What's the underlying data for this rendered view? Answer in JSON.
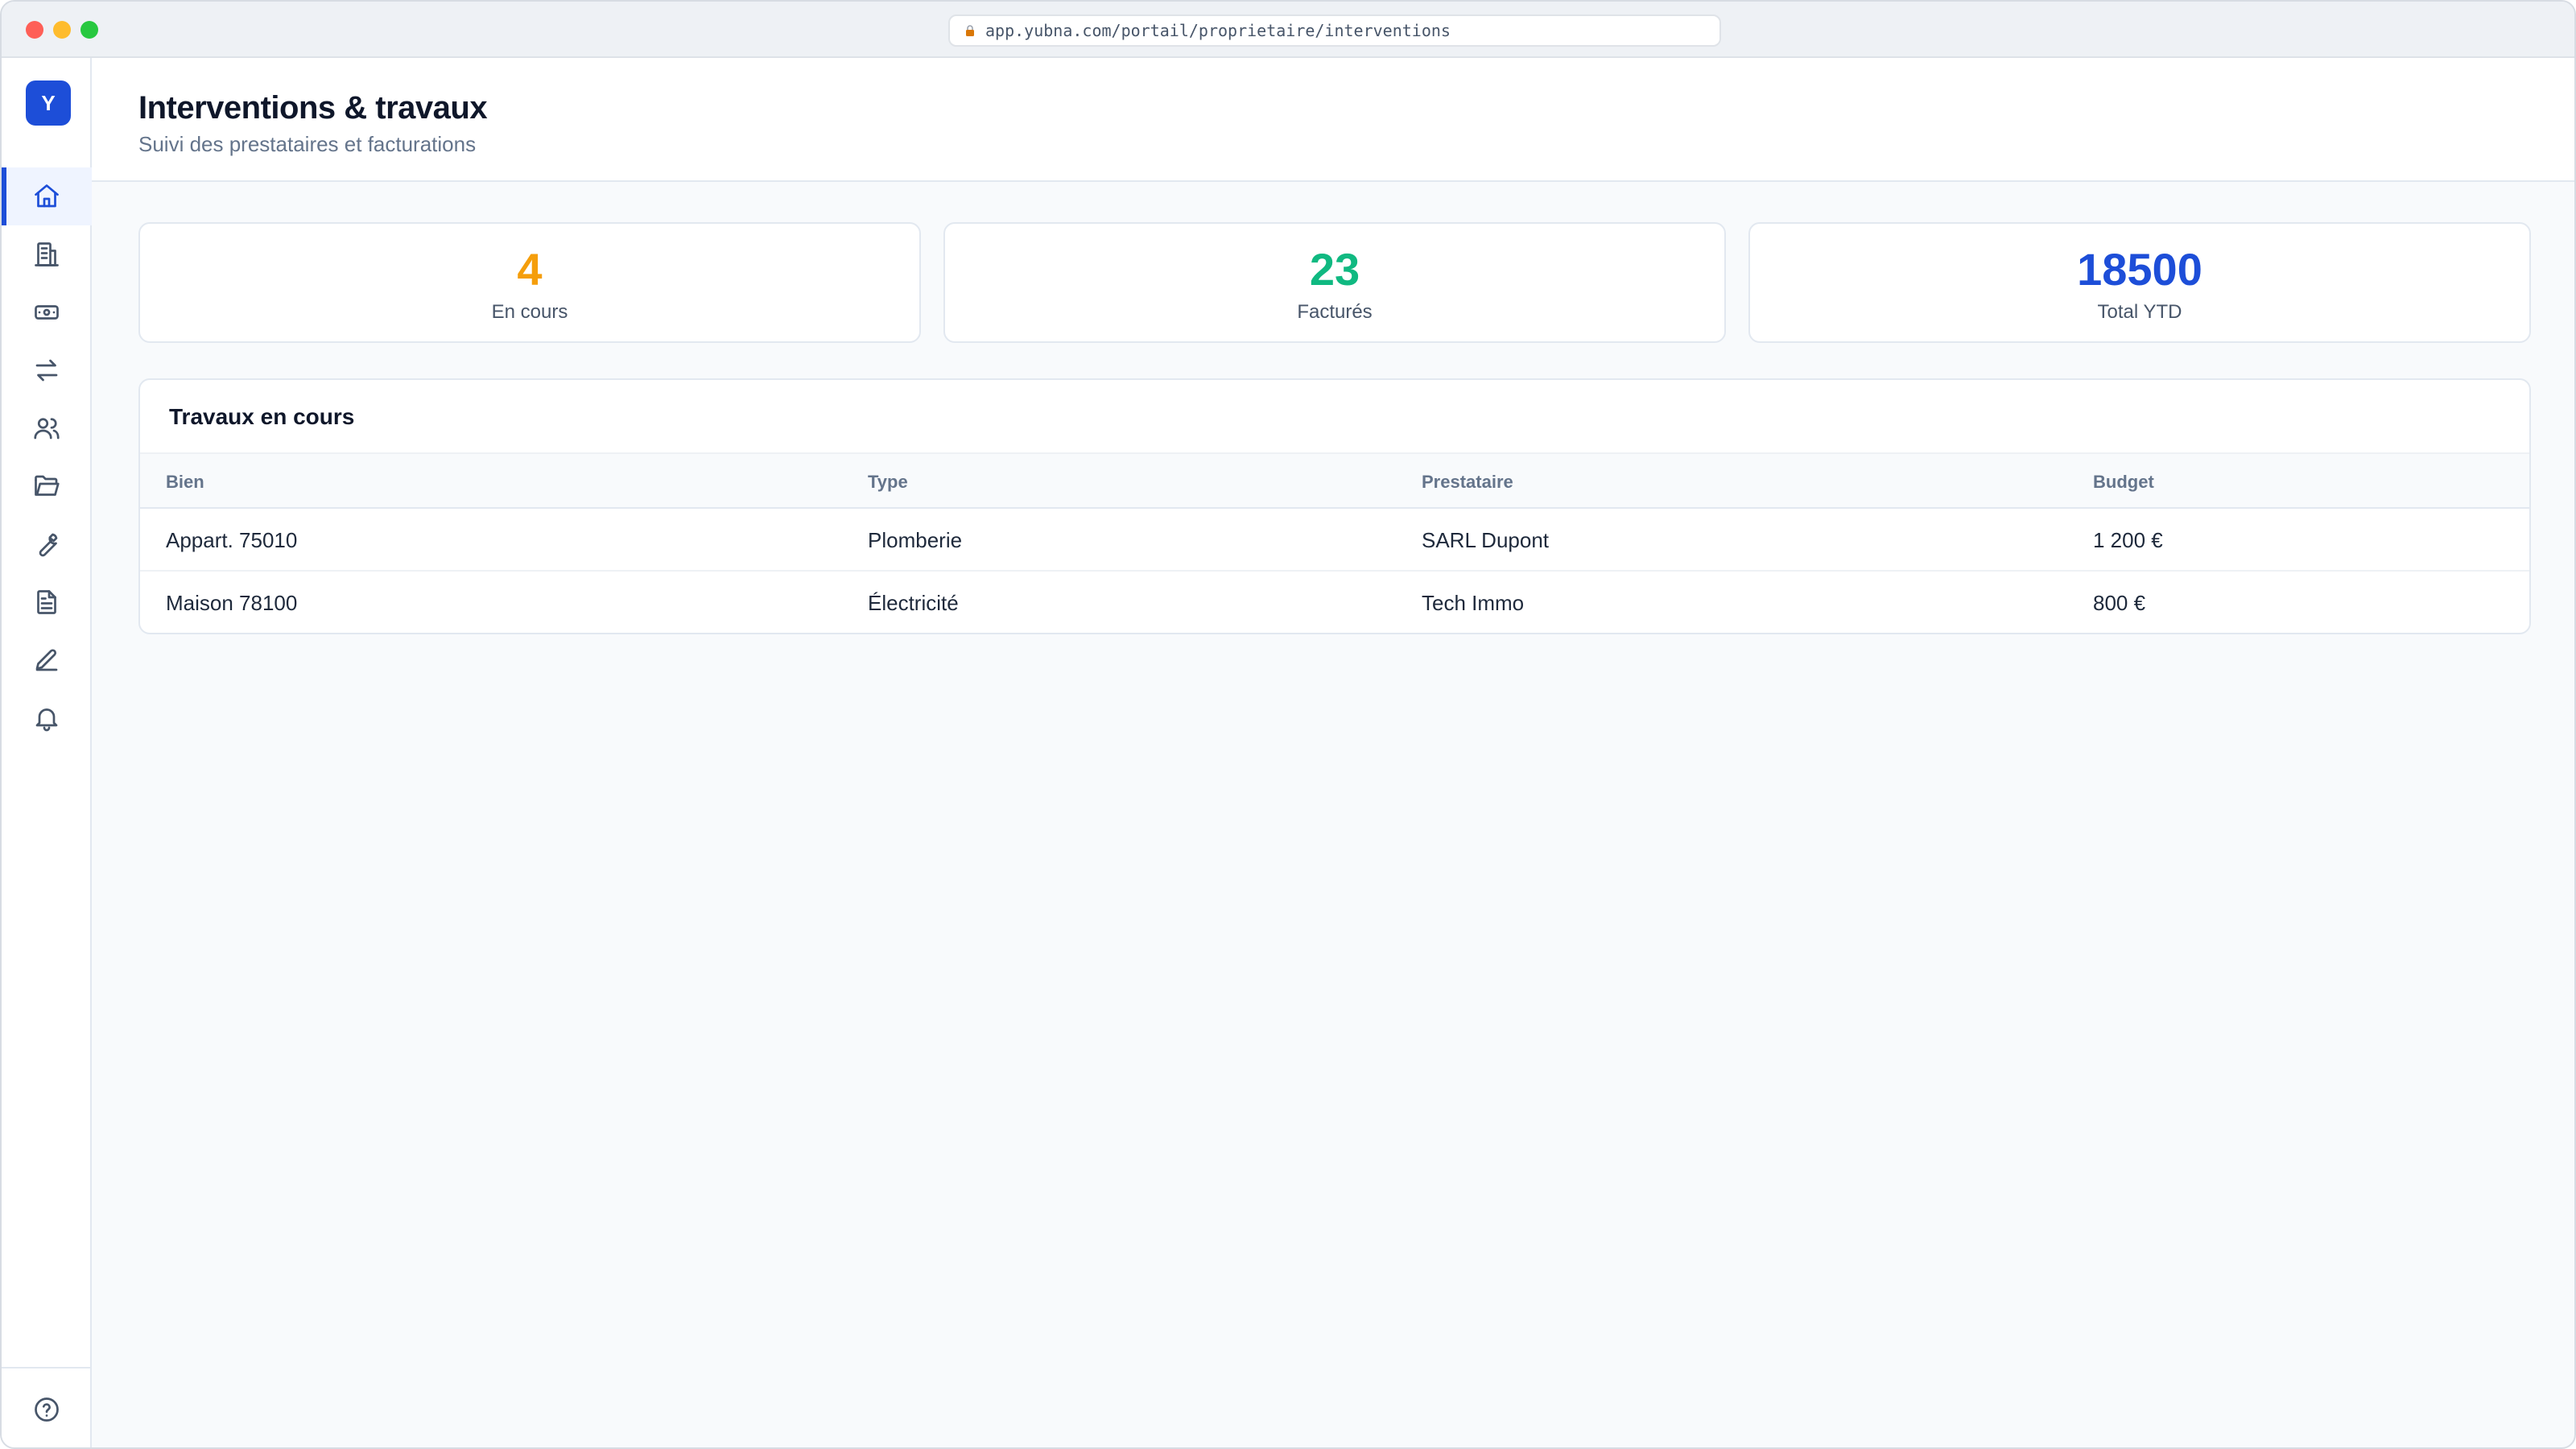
{
  "browser": {
    "url": "app.yubna.com/portail/proprietaire/interventions"
  },
  "sidebar": {
    "logo_letter": "Y",
    "items": [
      {
        "icon": "home-icon",
        "active": true
      },
      {
        "icon": "building-icon",
        "active": false
      },
      {
        "icon": "banknote-icon",
        "active": false
      },
      {
        "icon": "transfer-arrows-icon",
        "active": false
      },
      {
        "icon": "users-icon",
        "active": false
      },
      {
        "icon": "folder-open-icon",
        "active": false
      },
      {
        "icon": "wrench-icon",
        "active": false
      },
      {
        "icon": "document-icon",
        "active": false
      },
      {
        "icon": "pen-icon",
        "active": false
      },
      {
        "icon": "bell-icon",
        "active": false
      }
    ],
    "bottom_icon": "help-circle-icon"
  },
  "header": {
    "title": "Interventions & travaux",
    "subtitle": "Suivi des prestataires et facturations"
  },
  "stats": [
    {
      "value": "4",
      "label": "En cours",
      "color": "#f59e0b"
    },
    {
      "value": "23",
      "label": "Facturés",
      "color": "#10b981"
    },
    {
      "value": "18500",
      "label": "Total YTD",
      "color": "#1d4ed8"
    }
  ],
  "table": {
    "title": "Travaux en cours",
    "columns": [
      "Bien",
      "Type",
      "Prestataire",
      "Budget"
    ],
    "rows": [
      [
        "Appart. 75010",
        "Plomberie",
        "SARL Dupont",
        "1 200 €"
      ],
      [
        "Maison 78100",
        "Électricité",
        "Tech Immo",
        "800 €"
      ]
    ]
  },
  "colors": {
    "accent": "#1d4ed8",
    "icon": "#475569"
  }
}
